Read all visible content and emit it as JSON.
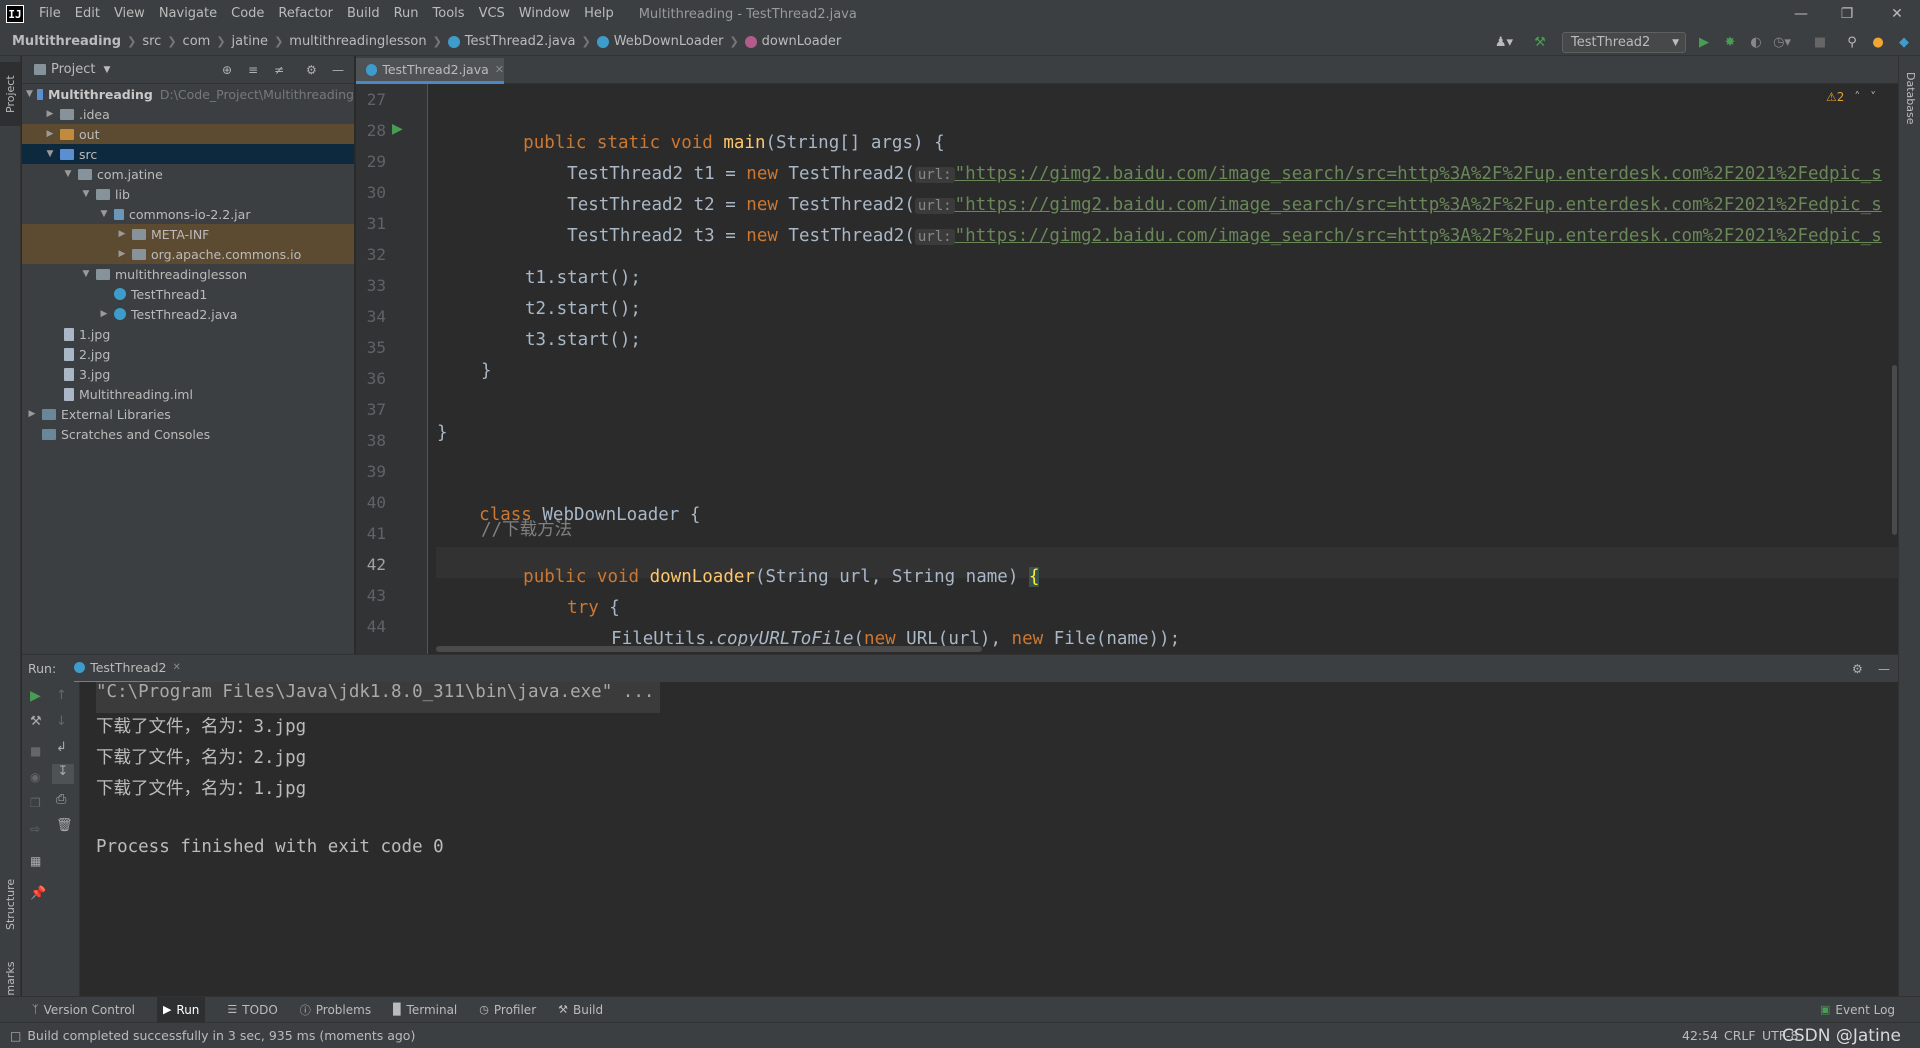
{
  "app": {
    "logo": "IJ",
    "menu": [
      "File",
      "Edit",
      "View",
      "Navigate",
      "Code",
      "Refactor",
      "Build",
      "Run",
      "Tools",
      "VCS",
      "Window",
      "Help"
    ],
    "window_title": "Multithreading - TestThread2.java"
  },
  "breadcrumb": [
    "Multithreading",
    "src",
    "com",
    "jatine",
    "multithreadinglesson",
    "TestThread2.java",
    "WebDownLoader",
    "downLoader"
  ],
  "run_config": "TestThread2",
  "left_stripe": {
    "project": "Project",
    "structure": "Structure",
    "bookmarks": "Bookmarks"
  },
  "right_stripe": {
    "database": "Database"
  },
  "project_panel": {
    "title": "Project",
    "tree": [
      {
        "label": "Multithreading",
        "extra": "D:\\Code_Project\\Multithreading"
      },
      {
        "label": ".idea"
      },
      {
        "label": "out"
      },
      {
        "label": "src"
      },
      {
        "label": "com.jatine"
      },
      {
        "label": "lib"
      },
      {
        "label": "commons-io-2.2.jar"
      },
      {
        "label": "META-INF"
      },
      {
        "label": "org.apache.commons.io"
      },
      {
        "label": "multithreadinglesson"
      },
      {
        "label": "TestThread1"
      },
      {
        "label": "TestThread2.java"
      },
      {
        "label": "1.jpg"
      },
      {
        "label": "2.jpg"
      },
      {
        "label": "3.jpg"
      },
      {
        "label": "Multithreading.iml"
      },
      {
        "label": "External Libraries"
      },
      {
        "label": "Scratches and Consoles"
      }
    ]
  },
  "editor": {
    "tab": "TestThread2.java",
    "warnings": "2",
    "lines": [
      "27",
      "28",
      "29",
      "30",
      "31",
      "32",
      "33",
      "34",
      "35",
      "36",
      "37",
      "38",
      "39",
      "40",
      "41",
      "42",
      "43",
      "44"
    ],
    "code": {
      "l28a": "public static void ",
      "l28b": "main",
      "l28c": "(String[] args) {",
      "t1": "TestThread2 t1 = ",
      "t2": "TestThread2 t2 = ",
      "t3": "TestThread2 t3 = ",
      "new_kw": "new",
      "ctor": " TestThread2(",
      "hint": "url:",
      "url": "\"https://gimg2.baidu.com/image_search/src=http%3A%2F%2Fup.enterdesk.com%2F2021%2Fedpic_s",
      "s1": "t1.start();",
      "s2": "t2.start();",
      "s3": "t3.start();",
      "close1": "}",
      "close2": "}",
      "cls_kw": "class",
      "cls_name": " WebDownLoader {",
      "comment": "//下载方法",
      "l42a": "public void ",
      "l42b": "downLoader",
      "l42c": "(String url, String name) ",
      "l42d": "{",
      "try_kw": "try",
      "try_rest": " {",
      "l44a": "FileUtils.",
      "l44b": "copyURLToFile",
      "l44c": "(",
      "l44d": " URL(url), ",
      "l44e": " File(name));"
    }
  },
  "run_panel": {
    "label": "Run:",
    "tab": "TestThread2",
    "output": [
      "\"C:\\Program Files\\Java\\jdk1.8.0_311\\bin\\java.exe\" ...",
      "下载了文件，名为：3.jpg",
      "下载了文件，名为：2.jpg",
      "下载了文件，名为：1.jpg",
      "",
      "Process finished with exit code 0"
    ]
  },
  "bottom_tools": [
    "Version Control",
    "Run",
    "TODO",
    "Problems",
    "Terminal",
    "Profiler",
    "Build"
  ],
  "event_log": "Event Log",
  "status": {
    "message": "Build completed successfully in 3 sec, 935 ms (moments ago)",
    "position": "42:54",
    "line_sep": "CRLF",
    "encoding": "UTF-8",
    "watermark": "CSDN @Jatine"
  },
  "colors": {
    "keyword": "#cc7832",
    "function": "#ffc66d",
    "string": "#6a8759",
    "comment": "#808080",
    "accent": "#4a88c7",
    "run_green": "#499c54"
  }
}
